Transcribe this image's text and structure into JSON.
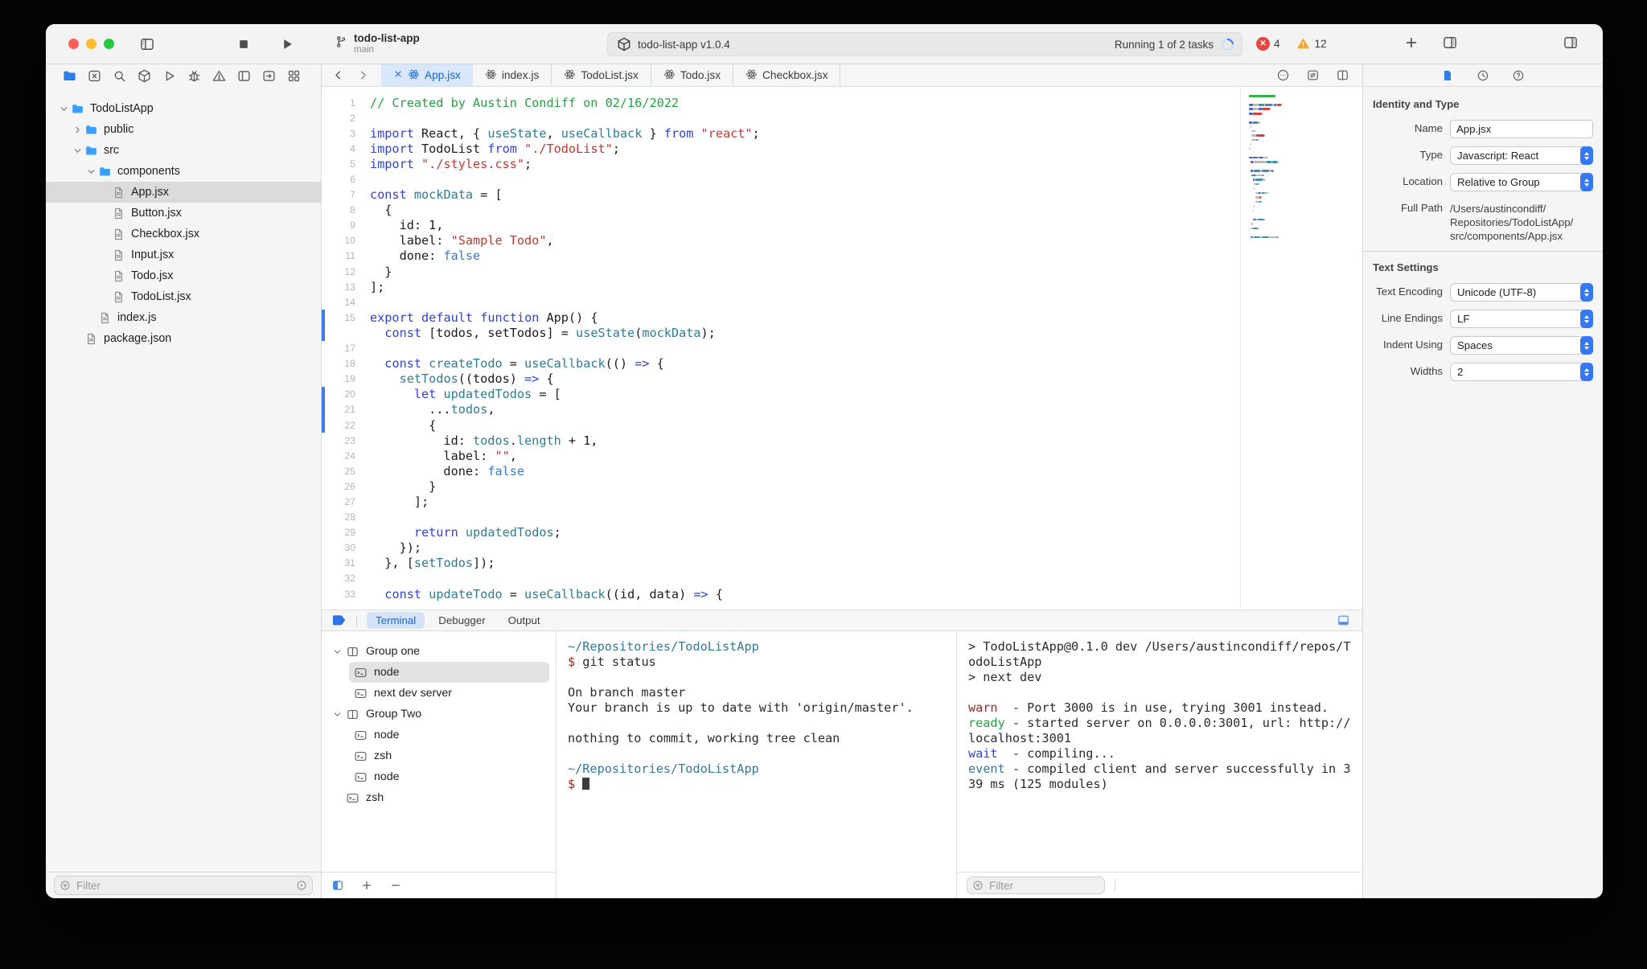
{
  "titlebar": {
    "project": "todo-list-app",
    "branch": "main",
    "scheme_pill": {
      "name": "todo-list-app v1.0.4",
      "status": "Running 1 of 2 tasks"
    },
    "error_count": "4",
    "warning_count": "12"
  },
  "colors": {
    "accent": "#3478f6",
    "error": "#e8463f",
    "warning": "#f5a623",
    "keyword": "#2f43d6",
    "identifier": "#2e7d95",
    "string": "#c03a32",
    "comment": "#23a33f"
  },
  "navigator": {
    "icons": [
      {
        "name": "project",
        "icon": "folder",
        "active": true
      },
      {
        "name": "source-control",
        "icon": "xsquare"
      },
      {
        "name": "search",
        "icon": "search"
      },
      {
        "name": "packages",
        "icon": "cube"
      },
      {
        "name": "run",
        "icon": "play"
      },
      {
        "name": "debug",
        "icon": "bug"
      },
      {
        "name": "issues",
        "icon": "warn"
      },
      {
        "name": "tabs",
        "icon": "tabicon"
      },
      {
        "name": "jump",
        "icon": "arrowin"
      },
      {
        "name": "extensions",
        "icon": "grid"
      }
    ],
    "tree": [
      {
        "depth": 0,
        "chev": "down",
        "icon": "folder",
        "label": "TodoListApp"
      },
      {
        "depth": 1,
        "chev": "right",
        "icon": "folder",
        "label": "public"
      },
      {
        "depth": 1,
        "chev": "down",
        "icon": "folder",
        "label": "src"
      },
      {
        "depth": 2,
        "chev": "down",
        "icon": "folder",
        "label": "components"
      },
      {
        "depth": 3,
        "chev": "",
        "icon": "doc",
        "label": "App.jsx",
        "selected": true
      },
      {
        "depth": 3,
        "chev": "",
        "icon": "doc",
        "label": "Button.jsx"
      },
      {
        "depth": 3,
        "chev": "",
        "icon": "doc",
        "label": "Checkbox.jsx"
      },
      {
        "depth": 3,
        "chev": "",
        "icon": "doc",
        "label": "Input.jsx"
      },
      {
        "depth": 3,
        "chev": "",
        "icon": "doc",
        "label": "Todo.jsx"
      },
      {
        "depth": 3,
        "chev": "",
        "icon": "doc",
        "label": "TodoList.jsx"
      },
      {
        "depth": 2,
        "chev": "",
        "icon": "doc",
        "label": "index.js"
      },
      {
        "depth": 1,
        "chev": "",
        "icon": "doc",
        "label": "package.json"
      }
    ],
    "filter_placeholder": "Filter"
  },
  "tabs": {
    "items": [
      {
        "label": "App.jsx",
        "active": true
      },
      {
        "label": "index.js"
      },
      {
        "label": "TodoList.jsx"
      },
      {
        "label": "Todo.jsx"
      },
      {
        "label": "Checkbox.jsx"
      }
    ]
  },
  "editor": {
    "change_bars": [
      [
        15,
        16
      ],
      [
        20,
        22
      ]
    ],
    "lines": [
      {
        "n": "1",
        "t": [
          [
            "cm",
            "// Created by Austin Condiff on 02/16/2022"
          ]
        ]
      },
      {
        "n": "2",
        "t": []
      },
      {
        "n": "3",
        "t": [
          [
            "kw",
            "import"
          ],
          [
            "pl",
            " React, { "
          ],
          [
            "id",
            "useState"
          ],
          [
            "pl",
            ", "
          ],
          [
            "id",
            "useCallback"
          ],
          [
            "pl",
            " } "
          ],
          [
            "kw",
            "from"
          ],
          [
            "pl",
            " "
          ],
          [
            "str",
            "\"react\""
          ],
          [
            "pl",
            ";"
          ]
        ]
      },
      {
        "n": "4",
        "t": [
          [
            "kw",
            "import"
          ],
          [
            "pl",
            " TodoList "
          ],
          [
            "kw",
            "from"
          ],
          [
            "pl",
            " "
          ],
          [
            "str",
            "\"./TodoList\""
          ],
          [
            "pl",
            ";"
          ]
        ]
      },
      {
        "n": "5",
        "t": [
          [
            "kw",
            "import"
          ],
          [
            "pl",
            " "
          ],
          [
            "str",
            "\"./styles.css\""
          ],
          [
            "pl",
            ";"
          ]
        ]
      },
      {
        "n": "6",
        "t": []
      },
      {
        "n": "7",
        "t": [
          [
            "kw",
            "const"
          ],
          [
            "pl",
            " "
          ],
          [
            "id",
            "mockData"
          ],
          [
            "pl",
            " = ["
          ]
        ]
      },
      {
        "n": "8",
        "t": [
          [
            "pl",
            "  {"
          ]
        ]
      },
      {
        "n": "9",
        "t": [
          [
            "pl",
            "    id: 1,"
          ]
        ]
      },
      {
        "n": "10",
        "t": [
          [
            "pl",
            "    label: "
          ],
          [
            "str",
            "\"Sample Todo\""
          ],
          [
            "pl",
            ","
          ]
        ]
      },
      {
        "n": "11",
        "t": [
          [
            "pl",
            "    done: "
          ],
          [
            "lt",
            "false"
          ]
        ]
      },
      {
        "n": "12",
        "t": [
          [
            "pl",
            "  }"
          ]
        ]
      },
      {
        "n": "13",
        "t": [
          [
            "pl",
            "];"
          ]
        ]
      },
      {
        "n": "14",
        "t": []
      },
      {
        "n": "15",
        "t": [
          [
            "kw",
            "export"
          ],
          [
            "pl",
            " "
          ],
          [
            "kw",
            "default"
          ],
          [
            "pl",
            " "
          ],
          [
            "kw",
            "function"
          ],
          [
            "pl",
            " App() {"
          ]
        ]
      },
      {
        "n": "",
        "t": [
          [
            "pl",
            "  "
          ],
          [
            "kw",
            "const"
          ],
          [
            "pl",
            " [todos, setTodos] = "
          ],
          [
            "id",
            "useState"
          ],
          [
            "pl",
            "("
          ],
          [
            "id",
            "mockData"
          ],
          [
            "pl",
            ");"
          ]
        ]
      },
      {
        "n": "17",
        "t": []
      },
      {
        "n": "18",
        "t": [
          [
            "pl",
            "  "
          ],
          [
            "kw",
            "const"
          ],
          [
            "pl",
            " "
          ],
          [
            "id",
            "createTodo"
          ],
          [
            "pl",
            " = "
          ],
          [
            "id",
            "useCallback"
          ],
          [
            "pl",
            "(() "
          ],
          [
            "kw",
            "=>"
          ],
          [
            "pl",
            " {"
          ]
        ]
      },
      {
        "n": "19",
        "t": [
          [
            "pl",
            "    "
          ],
          [
            "id",
            "setTodos"
          ],
          [
            "pl",
            "((todos) "
          ],
          [
            "kw",
            "=>"
          ],
          [
            "pl",
            " {"
          ]
        ]
      },
      {
        "n": "20",
        "t": [
          [
            "pl",
            "      "
          ],
          [
            "kw",
            "let"
          ],
          [
            "pl",
            " "
          ],
          [
            "id",
            "updatedTodos"
          ],
          [
            "pl",
            " = ["
          ]
        ]
      },
      {
        "n": "21",
        "t": [
          [
            "pl",
            "        ..."
          ],
          [
            "id",
            "todos"
          ],
          [
            "pl",
            ","
          ]
        ]
      },
      {
        "n": "22",
        "t": [
          [
            "pl",
            "        {"
          ]
        ]
      },
      {
        "n": "23",
        "t": [
          [
            "pl",
            "          id: "
          ],
          [
            "id",
            "todos"
          ],
          [
            "pl",
            "."
          ],
          [
            "id",
            "length"
          ],
          [
            "pl",
            " + 1,"
          ]
        ]
      },
      {
        "n": "24",
        "t": [
          [
            "pl",
            "          label: "
          ],
          [
            "str",
            "\"\""
          ],
          [
            "pl",
            ","
          ]
        ]
      },
      {
        "n": "25",
        "t": [
          [
            "pl",
            "          done: "
          ],
          [
            "lt",
            "false"
          ]
        ]
      },
      {
        "n": "26",
        "t": [
          [
            "pl",
            "        }"
          ]
        ]
      },
      {
        "n": "27",
        "t": [
          [
            "pl",
            "      ];"
          ]
        ]
      },
      {
        "n": "28",
        "t": []
      },
      {
        "n": "29",
        "t": [
          [
            "pl",
            "      "
          ],
          [
            "kw",
            "return"
          ],
          [
            "pl",
            " "
          ],
          [
            "id",
            "updatedTodos"
          ],
          [
            "pl",
            ";"
          ]
        ]
      },
      {
        "n": "30",
        "t": [
          [
            "pl",
            "    });"
          ]
        ]
      },
      {
        "n": "31",
        "t": [
          [
            "pl",
            "  }, ["
          ],
          [
            "id",
            "setTodos"
          ],
          [
            "pl",
            "]);"
          ]
        ]
      },
      {
        "n": "32",
        "t": []
      },
      {
        "n": "33",
        "t": [
          [
            "pl",
            "  "
          ],
          [
            "kw",
            "const"
          ],
          [
            "pl",
            " "
          ],
          [
            "id",
            "updateTodo"
          ],
          [
            "pl",
            " = "
          ],
          [
            "id",
            "useCallback"
          ],
          [
            "pl",
            "((id, data) "
          ],
          [
            "kw",
            "=>"
          ],
          [
            "pl",
            " {"
          ]
        ]
      }
    ]
  },
  "debugbar": {
    "tabs": [
      "Terminal",
      "Debugger",
      "Output"
    ],
    "active": "Terminal"
  },
  "terminal": {
    "groups": [
      {
        "type": "group",
        "chev": "down",
        "label": "Group one",
        "depth": 0
      },
      {
        "type": "term",
        "label": "node",
        "depth": 1,
        "selected": true
      },
      {
        "type": "term",
        "label": "next dev server",
        "depth": 1
      },
      {
        "type": "group",
        "chev": "down",
        "label": "Group Two",
        "depth": 0
      },
      {
        "type": "term",
        "label": "node",
        "depth": 1
      },
      {
        "type": "term",
        "label": "zsh",
        "depth": 1
      },
      {
        "type": "term",
        "label": "node",
        "depth": 1
      },
      {
        "type": "term",
        "label": "zsh",
        "depth": 0
      }
    ],
    "middle": [
      [
        [
          "path",
          "~/Repositories/TodoListApp"
        ]
      ],
      [
        [
          "prompt",
          "$"
        ],
        [
          "pl",
          " git status"
        ]
      ],
      [],
      [
        [
          "pl",
          "On branch master"
        ]
      ],
      [
        [
          "pl",
          "Your branch is up to date with 'origin/master'."
        ]
      ],
      [],
      [
        [
          "pl",
          "nothing to commit, working tree clean"
        ]
      ],
      [],
      [
        [
          "path",
          "~/Repositories/TodoListApp"
        ]
      ],
      [
        [
          "prompt",
          "$"
        ],
        [
          "pl",
          " "
        ],
        [
          "cursor",
          ""
        ]
      ]
    ],
    "right": [
      [
        [
          "pl",
          "> TodoListApp@0.1.0 dev /Users/austincondiff/repos/TodoListApp"
        ]
      ],
      [
        [
          "pl",
          "> next dev"
        ]
      ],
      [],
      [
        [
          "warn",
          "warn"
        ],
        [
          "pl",
          "  - Port 3000 is in use, trying 3001 instead."
        ]
      ],
      [
        [
          "ready",
          "ready"
        ],
        [
          "pl",
          " - started server on 0.0.0.0:3001, url: http://localhost:3001"
        ]
      ],
      [
        [
          "wait",
          "wait"
        ],
        [
          "pl",
          "  - compiling..."
        ]
      ],
      [
        [
          "event",
          "event"
        ],
        [
          "pl",
          " - compiled client and server successfully in 339 ms (125 modules)"
        ]
      ]
    ],
    "filter_placeholder": "Filter"
  },
  "inspector": {
    "sections": [
      {
        "title": "Identity and Type",
        "rows": [
          {
            "label": "Name",
            "type": "input",
            "value": "App.jsx"
          },
          {
            "label": "Type",
            "type": "select",
            "value": "Javascript: React"
          },
          {
            "label": "Location",
            "type": "select",
            "value": "Relative to Group"
          },
          {
            "label": "Full Path",
            "type": "text",
            "value": "/Users/austincondiff/\nRepositories/TodoListApp/\nsrc/components/App.jsx"
          }
        ]
      },
      {
        "title": "Text Settings",
        "rows": [
          {
            "label": "Text Encoding",
            "type": "select",
            "value": "Unicode (UTF-8)"
          },
          {
            "label": "Line Endings",
            "type": "select",
            "value": "LF"
          },
          {
            "label": "Indent Using",
            "type": "select",
            "value": "Spaces"
          },
          {
            "label": "Widths",
            "type": "select",
            "value": "2"
          }
        ]
      }
    ]
  }
}
